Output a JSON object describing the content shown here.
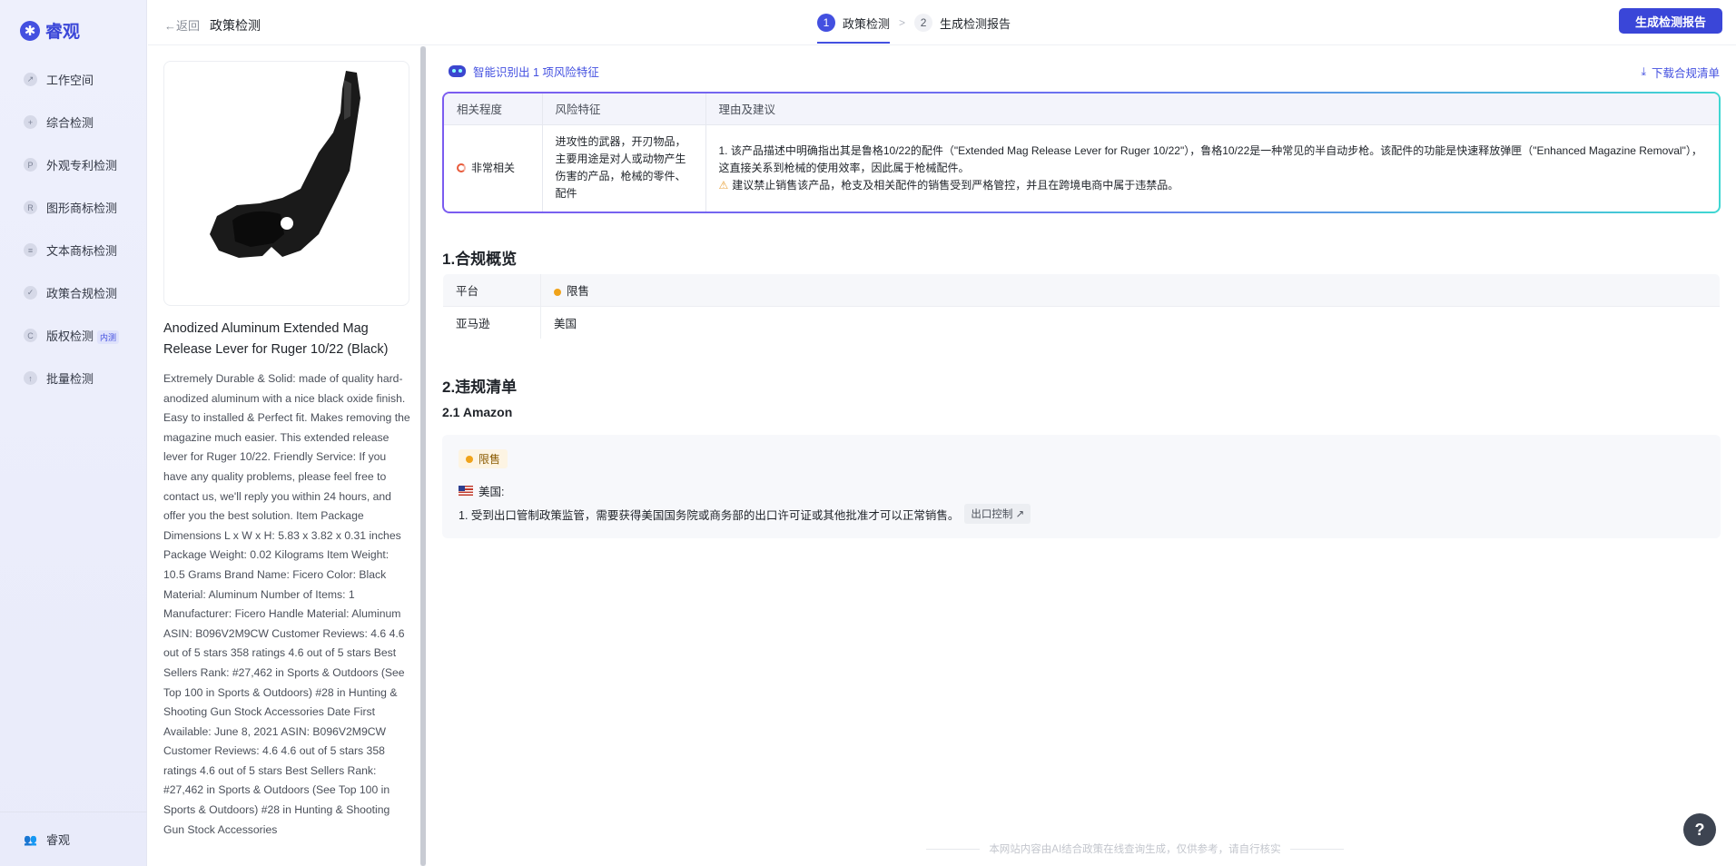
{
  "app": {
    "brand": "睿观",
    "logo_glyph": "✱"
  },
  "sidebar": {
    "items": [
      {
        "label": "工作空间",
        "icon_glyph": "↗",
        "icon": "trend-icon"
      },
      {
        "label": "综合检测",
        "icon_glyph": "+",
        "icon": "search-plus-icon"
      },
      {
        "label": "外观专利检测",
        "icon_glyph": "P",
        "icon": "patent-icon"
      },
      {
        "label": "图形商标检测",
        "icon_glyph": "R",
        "icon": "trademark-icon"
      },
      {
        "label": "文本商标检测",
        "icon_glyph": "≡",
        "icon": "text-icon"
      },
      {
        "label": "政策合规检测",
        "icon_glyph": "✓",
        "icon": "check-circle-icon"
      },
      {
        "label": "版权检测",
        "badge": "内测",
        "icon_glyph": "C",
        "icon": "copyright-icon"
      },
      {
        "label": "批量检测",
        "icon_glyph": "↑",
        "icon": "upload-icon"
      }
    ],
    "footer_label": "睿观",
    "footer_icon_glyph": "👥"
  },
  "header": {
    "back_label": "←返回",
    "title": "政策检测",
    "steps": [
      {
        "num": "1",
        "label": "政策检测",
        "active": true
      },
      {
        "num": "2",
        "label": "生成检测报告",
        "active": false
      }
    ],
    "step_separator": ">",
    "primary_button": "生成检测报告"
  },
  "product": {
    "name": "Anodized Aluminum Extended Mag Release Lever for Ruger 10/22 (Black)",
    "description": "Extremely Durable & Solid: made of quality hard-anodized aluminum with a nice black oxide finish. Easy to installed & Perfect fit. Makes removing the magazine much easier. This extended release lever for Ruger 10/22. Friendly Service: If you have any quality problems, please feel free to contact us, we'll reply you within 24 hours, and offer you the best solution. Item Package Dimensions L x W x H: 5.83 x 3.82 x 0.31 inches Package Weight: 0.02 Kilograms Item Weight: 10.5 Grams Brand Name: Ficero Color: Black Material: Aluminum Number of Items: 1 Manufacturer: Ficero Handle Material: Aluminum ASIN: B096V2M9CW Customer Reviews: 4.6 4.6 out of 5 stars 358 ratings 4.6 out of 5 stars Best Sellers Rank: #27,462 in Sports & Outdoors (See Top 100 in Sports & Outdoors) #28 in Hunting & Shooting Gun Stock Accessories Date First Available: June 8, 2021 ASIN: B096V2M9CW Customer Reviews: 4.6 4.6 out of 5 stars 358 ratings 4.6 out of 5 stars Best Sellers Rank: #27,462 in Sports & Outdoors (See Top 100 in Sports & Outdoors) #28 in Hunting & Shooting Gun Stock Accessories"
  },
  "risk": {
    "summary": "智能识别出 1 项风险特征",
    "download_label": "下载合规清单",
    "download_glyph": "⤓",
    "columns": [
      "相关程度",
      "风险特征",
      "理由及建议"
    ],
    "row": {
      "level": "非常相关",
      "feature": "进攻性的武器，开刃物品，主要用途是对人或动物产生伤害的产品，枪械的零件、配件",
      "reason": "1. 该产品描述中明确指出其是鲁格10/22的配件（\"Extended Mag Release Lever for Ruger 10/22\"），鲁格10/22是一种常见的半自动步枪。该配件的功能是快速释放弹匣（\"Enhanced Magazine Removal\"），这直接关系到枪械的使用效率，因此属于枪械配件。",
      "warning_glyph": "⚠",
      "suggestion": "建议禁止销售该产品，枪支及相关配件的销售受到严格管控，并且在跨境电商中属于违禁品。"
    }
  },
  "overview": {
    "title": "1.合规概览",
    "header": {
      "platform": "平台",
      "status": "限售"
    },
    "rows": [
      {
        "platform": "亚马逊",
        "region": "美国"
      }
    ]
  },
  "violations": {
    "title": "2.违规清单",
    "subtitle": "2.1 Amazon",
    "tag": "限售",
    "country": "美国:",
    "item_text": "1. 受到出口管制政策监管，需要获得美国国务院或商务部的出口许可证或其他批准才可以正常销售。",
    "chip_label": "出口控制 ↗"
  },
  "footer_note": "本网站内容由AI结合政策在线查询生成，仅供参考，请自行核实",
  "help_label": "?",
  "colors": {
    "accent": "#4350e0",
    "warning": "#f0a31a",
    "danger": "#e85a3a"
  }
}
